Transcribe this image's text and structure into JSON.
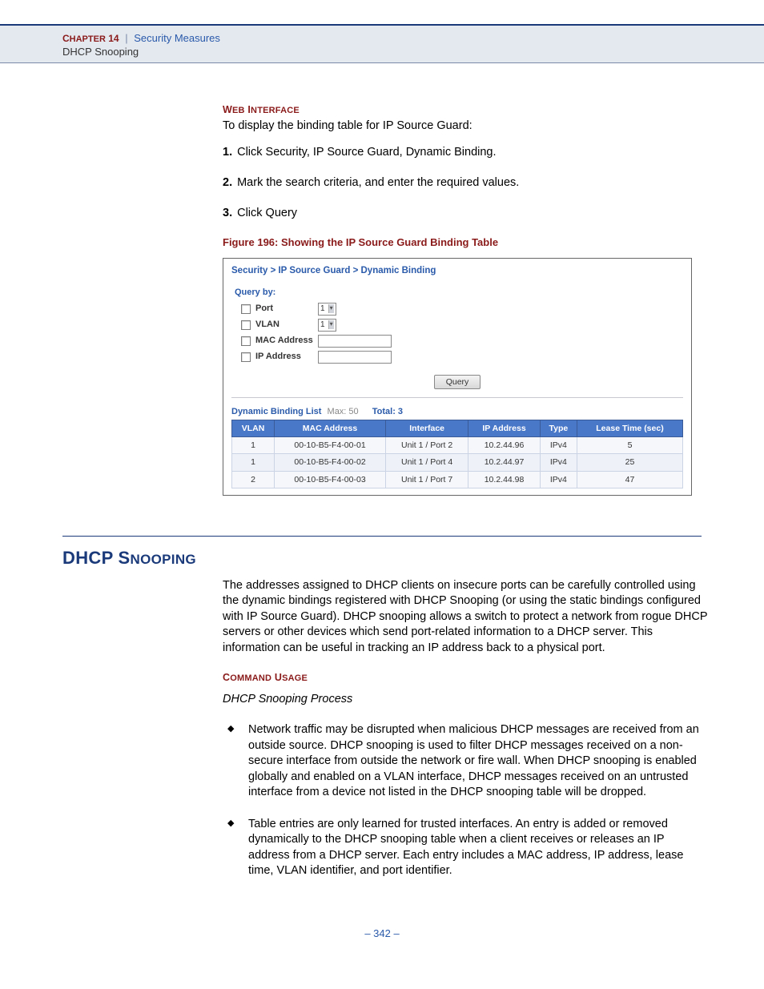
{
  "header": {
    "chapter_prefix": "C",
    "chapter_rest": "HAPTER",
    "chapter_number": "14",
    "chapter_title": "Security Measures",
    "subsection": "DHCP Snooping"
  },
  "web_interface": {
    "label_prefix": "W",
    "label_mid": "EB",
    "label_space": " I",
    "label_end": "NTERFACE",
    "intro": "To display the binding table for IP Source Guard:",
    "steps": [
      "Click Security, IP Source Guard, Dynamic Binding.",
      "Mark the search criteria, and enter the required values.",
      "Click Query"
    ]
  },
  "figure": {
    "caption": "Figure 196:  Showing the IP Source Guard Binding Table"
  },
  "screenshot": {
    "breadcrumb": "Security > IP Source Guard > Dynamic Binding",
    "query_by_label": "Query by:",
    "fields": {
      "port": {
        "label": "Port",
        "value": "1"
      },
      "vlan": {
        "label": "VLAN",
        "value": "1"
      },
      "mac": {
        "label": "MAC Address"
      },
      "ip": {
        "label": "IP Address"
      }
    },
    "query_button": "Query",
    "list_title": "Dynamic Binding List",
    "list_max": "Max: 50",
    "list_total": "Total: 3",
    "columns": [
      "VLAN",
      "MAC Address",
      "Interface",
      "IP Address",
      "Type",
      "Lease Time (sec)"
    ],
    "rows": [
      [
        "1",
        "00-10-B5-F4-00-01",
        "Unit 1 / Port 2",
        "10.2.44.96",
        "IPv4",
        "5"
      ],
      [
        "1",
        "00-10-B5-F4-00-02",
        "Unit 1 / Port 4",
        "10.2.44.97",
        "IPv4",
        "25"
      ],
      [
        "2",
        "00-10-B5-F4-00-03",
        "Unit 1 / Port 7",
        "10.2.44.98",
        "IPv4",
        "47"
      ]
    ]
  },
  "dhcp": {
    "heading_prefix": "DHCP S",
    "heading_rest": "NOOPING",
    "para": "The addresses assigned to DHCP clients on insecure ports can be carefully controlled using the dynamic bindings registered with DHCP Snooping (or using the static bindings configured with IP Source Guard). DHCP snooping allows a switch to protect a network from rogue DHCP servers or other devices which send port-related information to a DHCP server. This information can be useful in tracking an IP address back to a physical port.",
    "cmd_prefix": "C",
    "cmd_mid": "OMMAND",
    "cmd_space": " U",
    "cmd_end": "SAGE",
    "subheading": "DHCP Snooping Process",
    "bullets": [
      "Network traffic may be disrupted when malicious DHCP messages are received from an outside source. DHCP snooping is used to filter DHCP messages received on a non-secure interface from outside the network or fire wall. When DHCP snooping is enabled globally and enabled on a VLAN interface, DHCP messages received on an untrusted interface from a device not listed in the DHCP snooping table will be dropped.",
      "Table entries are only learned for trusted interfaces. An entry is added or removed dynamically to the DHCP snooping table when a client receives or releases an IP address from a DHCP server. Each entry includes a MAC address, IP address, lease time, VLAN identifier, and port identifier."
    ]
  },
  "page_number": "–  342  –"
}
